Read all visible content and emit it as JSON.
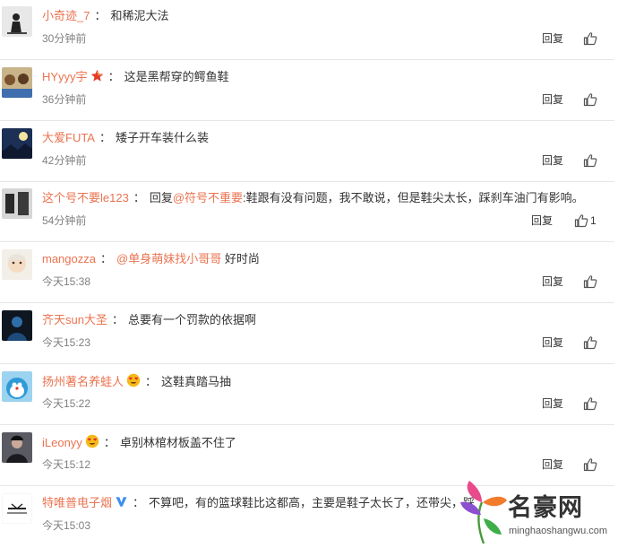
{
  "comments": [
    {
      "username": "小奇迹_7",
      "text": "和稀泥大法",
      "time": "30分钟前",
      "reply": "回复"
    },
    {
      "username": "HYyyy宇",
      "text": "这是黑帮穿的鳄鱼鞋",
      "time": "36分钟前",
      "reply": "回复",
      "badge": "star-icon"
    },
    {
      "username": "大爱FUTA",
      "text": "矮子开车装什么装",
      "time": "42分钟前",
      "reply": "回复"
    },
    {
      "username": "这个号不要le123",
      "reply_prefix": "回复",
      "mention": "@符号不重要",
      "text": ":鞋跟有没有问题，我不敢说，但是鞋尖太长，踩刹车油门有影响。",
      "time": "54分钟前",
      "reply": "回复",
      "likes": "1"
    },
    {
      "username": "mangozza",
      "mention": "@单身萌妹找小哥哥",
      "text": " 好时尚",
      "time": "今天15:38",
      "reply": "回复"
    },
    {
      "username": "齐天sun大圣",
      "text": "总要有一个罚款的依据啊",
      "time": "今天15:23",
      "reply": "回复"
    },
    {
      "username": "扬州著名养蛙人",
      "text": "这鞋真踏马抽",
      "time": "今天15:22",
      "reply": "回复",
      "badge": "emoji-heart-eyes-icon"
    },
    {
      "username": "iLeonyy",
      "text": "卓别林棺材板盖不住了",
      "time": "今天15:12",
      "reply": "回复",
      "badge": "emoji-heart-eyes-icon"
    },
    {
      "username": "特唯普电子烟",
      "text": "不算吧，有的篮球鞋比这都高，主要是鞋子太长了，还带尖，踩",
      "time": "今天15:03",
      "reply": "回复",
      "badge": "verified-v-icon"
    }
  ],
  "colors": {
    "username": "#eb7350",
    "text": "#333333",
    "time": "#808080",
    "divider": "#e6e6e6"
  },
  "watermark": {
    "title": "名豪网",
    "url": "minghaoshangwu.com"
  }
}
